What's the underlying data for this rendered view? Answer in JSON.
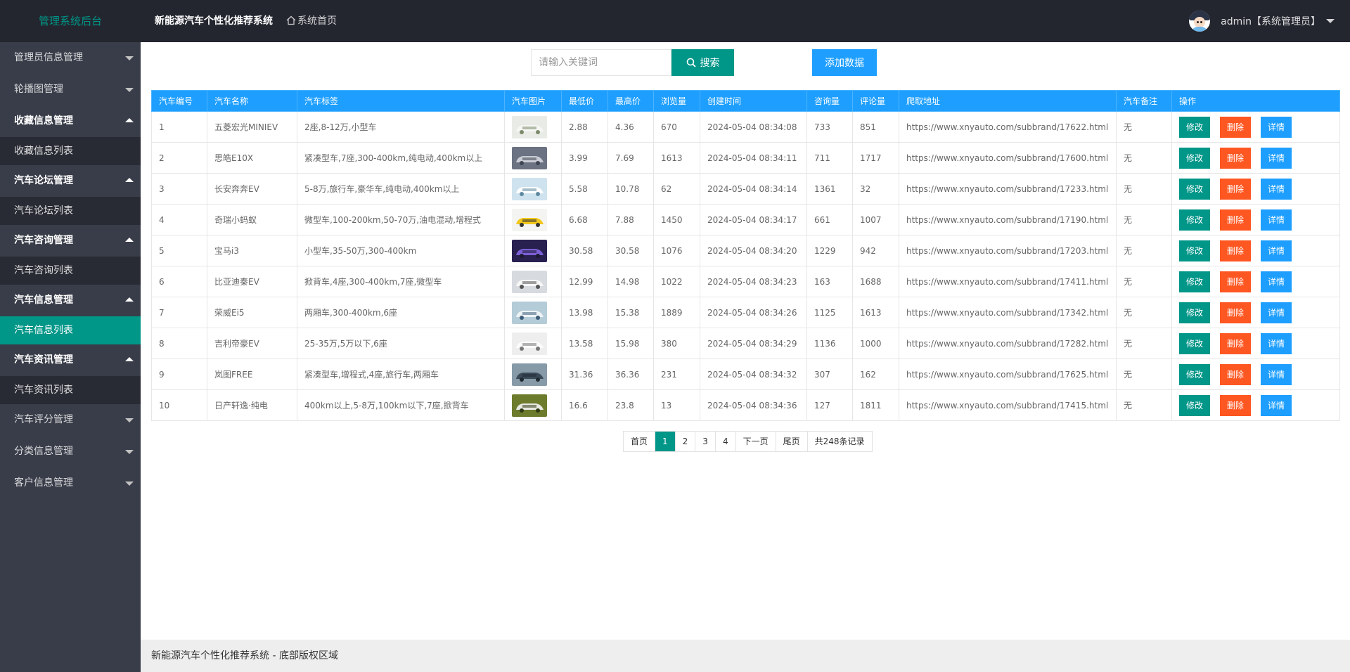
{
  "header": {
    "logo": "管理系统后台",
    "system_title": "新能源汽车个性化推荐系统",
    "home_link": "系统首页",
    "user_label": "admin【系统管理员】"
  },
  "sidebar": {
    "items": [
      {
        "label": "管理员信息管理",
        "open": false
      },
      {
        "label": "轮播图管理",
        "open": false
      },
      {
        "label": "收藏信息管理",
        "open": true,
        "sub": "收藏信息列表"
      },
      {
        "label": "汽车论坛管理",
        "open": true,
        "sub": "汽车论坛列表"
      },
      {
        "label": "汽车咨询管理",
        "open": true,
        "sub": "汽车咨询列表"
      },
      {
        "label": "汽车信息管理",
        "open": true,
        "sub": "汽车信息列表",
        "active": true
      },
      {
        "label": "汽车资讯管理",
        "open": true,
        "sub": "汽车资讯列表"
      },
      {
        "label": "汽车评分管理",
        "open": false
      },
      {
        "label": "分类信息管理",
        "open": false
      },
      {
        "label": "客户信息管理",
        "open": false
      }
    ]
  },
  "toolbar": {
    "search_placeholder": "请输入关键词",
    "search_label": "搜索",
    "add_label": "添加数据"
  },
  "table": {
    "columns": [
      "汽车编号",
      "汽车名称",
      "汽车标签",
      "汽车图片",
      "最低价",
      "最高价",
      "浏览量",
      "创建时间",
      "咨询量",
      "评论量",
      "爬取地址",
      "汽车备注",
      "操作"
    ],
    "action_labels": {
      "edit": "修改",
      "delete": "删除",
      "detail": "详情"
    },
    "rows": [
      {
        "id": "1",
        "name": "五菱宏光MINIEV",
        "tags": "2座,8-12万,小型车",
        "img": "car-white-mini",
        "min": "2.88",
        "max": "4.36",
        "views": "670",
        "created": "2024-05-04 08:34:08",
        "consult": "733",
        "comments": "851",
        "url": "https://www.xnyauto.com/subbrand/17622.html",
        "note": "无"
      },
      {
        "id": "2",
        "name": "思皓E10X",
        "tags": "紧凑型车,7座,300-400km,纯电动,400km以上",
        "img": "car-silver",
        "min": "3.99",
        "max": "7.69",
        "views": "1613",
        "created": "2024-05-04 08:34:11",
        "consult": "711",
        "comments": "1717",
        "url": "https://www.xnyauto.com/subbrand/17600.html",
        "note": "无"
      },
      {
        "id": "3",
        "name": "长安奔奔EV",
        "tags": "5-8万,旅行车,豪华车,纯电动,400km以上",
        "img": "car-outdoor",
        "min": "5.58",
        "max": "10.78",
        "views": "62",
        "created": "2024-05-04 08:34:14",
        "consult": "1361",
        "comments": "32",
        "url": "https://www.xnyauto.com/subbrand/17233.html",
        "note": "无"
      },
      {
        "id": "4",
        "name": "奇瑞小蚂蚁",
        "tags": "微型车,100-200km,50-70万,油电混动,增程式",
        "img": "car-yellow",
        "min": "6.68",
        "max": "7.88",
        "views": "1450",
        "created": "2024-05-04 08:34:17",
        "consult": "661",
        "comments": "1007",
        "url": "https://www.xnyauto.com/subbrand/17190.html",
        "note": "无"
      },
      {
        "id": "5",
        "name": "宝马i3",
        "tags": "小型车,35-50万,300-400km",
        "img": "car-purple",
        "min": "30.58",
        "max": "30.58",
        "views": "1076",
        "created": "2024-05-04 08:34:20",
        "consult": "1229",
        "comments": "942",
        "url": "https://www.xnyauto.com/subbrand/17203.html",
        "note": "无"
      },
      {
        "id": "6",
        "name": "比亚迪秦EV",
        "tags": "掀背车,4座,300-400km,7座,微型车",
        "img": "car-white-sedan",
        "min": "12.99",
        "max": "14.98",
        "views": "1022",
        "created": "2024-05-04 08:34:23",
        "consult": "163",
        "comments": "1688",
        "url": "https://www.xnyauto.com/subbrand/17411.html",
        "note": "无"
      },
      {
        "id": "7",
        "name": "荣威Ei5",
        "tags": "两厢车,300-400km,6座",
        "img": "car-blue-street",
        "min": "13.98",
        "max": "15.38",
        "views": "1889",
        "created": "2024-05-04 08:34:26",
        "consult": "1125",
        "comments": "1613",
        "url": "https://www.xnyauto.com/subbrand/17342.html",
        "note": "无"
      },
      {
        "id": "8",
        "name": "吉利帝豪EV",
        "tags": "25-35万,5万以下,6座",
        "img": "car-white-studio",
        "min": "13.58",
        "max": "15.98",
        "views": "380",
        "created": "2024-05-04 08:34:29",
        "consult": "1136",
        "comments": "1000",
        "url": "https://www.xnyauto.com/subbrand/17282.html",
        "note": "无"
      },
      {
        "id": "9",
        "name": "岚图FREE",
        "tags": "紧凑型车,增程式,4座,旅行车,两厢车",
        "img": "car-dark-suv",
        "min": "31.36",
        "max": "36.36",
        "views": "231",
        "created": "2024-05-04 08:34:32",
        "consult": "307",
        "comments": "162",
        "url": "https://www.xnyauto.com/subbrand/17625.html",
        "note": "无"
      },
      {
        "id": "10",
        "name": "日产轩逸·纯电",
        "tags": "400km以上,5-8万,100km以下,7座,掀背车",
        "img": "car-green-scene",
        "min": "16.6",
        "max": "23.8",
        "views": "13",
        "created": "2024-05-04 08:34:36",
        "consult": "127",
        "comments": "1811",
        "url": "https://www.xnyauto.com/subbrand/17415.html",
        "note": "无"
      }
    ]
  },
  "pagination": {
    "first": "首页",
    "pages": [
      "1",
      "2",
      "3",
      "4"
    ],
    "current": "1",
    "next": "下一页",
    "last": "尾页",
    "total": "共248条记录"
  },
  "footer": {
    "text": "新能源汽车个性化推荐系统 - 底部版权区域"
  },
  "colors": {
    "primary": "#009688",
    "blue": "#1e9fff",
    "danger": "#ff5722",
    "header_bg": "#23262e",
    "sidebar_bg": "#393d49"
  }
}
